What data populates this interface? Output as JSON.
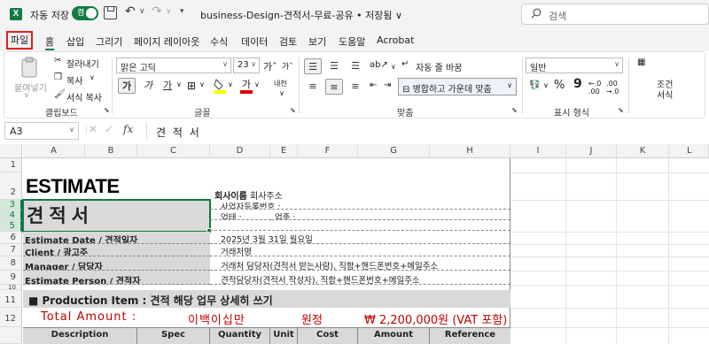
{
  "titlebar": {
    "app_logo": "X",
    "autosave_label": "자동 저장",
    "autosave_state": "켬",
    "doc_title": "business-Design-견적서-무료-공유 • 저장됨 ∨",
    "search_placeholder": "검색"
  },
  "menu": {
    "tabs": [
      "파일",
      "홈",
      "삽입",
      "그리기",
      "페이지 레이아웃",
      "수식",
      "데이터",
      "검토",
      "보기",
      "도움말",
      "Acrobat"
    ]
  },
  "ribbon": {
    "clipboard": {
      "paste": "붙여넣기",
      "cut": "잘라내기",
      "copy": "복사",
      "format_painter": "서식 복사",
      "group_label": "클립보드"
    },
    "font": {
      "font_name": "맑은 고딕",
      "font_size": "23",
      "group_label": "글꼴",
      "bold": "가",
      "italic": "가",
      "underline": "가",
      "phonetic": "내천"
    },
    "alignment": {
      "wrap_text": "자동 줄 바꿈",
      "merge_center": "병합하고 가운데 맞춤",
      "group_label": "맞춤"
    },
    "number": {
      "format": "일반",
      "group_label": "표시 형식",
      "percent": "%",
      "comma": "9"
    },
    "styles": {
      "conditional_1": "조건",
      "conditional_2": "서식"
    }
  },
  "formula_bar": {
    "name_box": "A3",
    "fx": "fx",
    "formula": "견 적 서"
  },
  "grid": {
    "columns": [
      "A",
      "B",
      "C",
      "D",
      "E",
      "F",
      "G",
      "H",
      "I",
      "J",
      "K",
      "L"
    ],
    "rows": [
      "1",
      "2",
      "3",
      "4",
      "5",
      "6",
      "7",
      "8",
      "9",
      "10",
      "11",
      "12"
    ]
  },
  "sheet": {
    "estimate_title": "ESTIMATE",
    "doc_title_kr": "견적서",
    "company_name_label": "회사이름",
    "company_address": "회사주소",
    "biz_reg_no": "사업자등록번호 :",
    "biz_type": "업태 :",
    "biz_item": "업종 :",
    "estimate_date_label": "Estimate Date / 견적일자",
    "estimate_date_value": "2025년 3월 31일 월요일",
    "client_label": "Client / 광고주",
    "client_value": "거래처명",
    "manager_label": "Manager / 담당자",
    "manager_value": "거래처 담당자(견적서 받는사람), 직함+핸드폰번호+메일주소",
    "estimator_label": "Estimate Person / 견적자",
    "estimator_value": "견적담당자(견적서 작성자), 직함+핸드폰번호+메일주소",
    "production_item": "■ Production Item  :  견적 해당 업무 상세히 쓰기",
    "total_label": "Total Amount :",
    "total_korean": "이백이십만",
    "total_won_unit": "원정",
    "total_numeric": "₩ 2,200,000원 (VAT 포함)",
    "table_headers": [
      "Description",
      "Spec",
      "Quantity",
      "Unit",
      "Cost",
      "Amount",
      "Reference"
    ]
  },
  "colors": {
    "excel_green": "#107c41",
    "highlight_gray": "#d9d9d9",
    "total_red": "#c00000",
    "file_tab_outline": "#e02020"
  }
}
